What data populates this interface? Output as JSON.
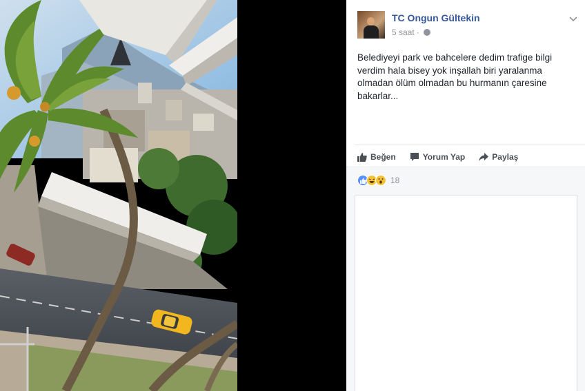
{
  "post": {
    "author": "TC Ongun Gültekin",
    "time": "5 saat",
    "separator": "·",
    "text": "Belediyeyi park ve bahcelere dedim trafige bilgi verdim hala bisey yok inşallah biri yaralanma olmadan ölüm olmadan bu hurmanın çaresine bakarlar...",
    "privacy_icon": "globe-icon",
    "menu_icon": "chevron-down-icon"
  },
  "actions": {
    "like_label": "Beğen",
    "comment_label": "Yorum Yap",
    "share_label": "Paylaş"
  },
  "reactions": {
    "types": [
      "like",
      "haha",
      "wow"
    ],
    "count": "18"
  },
  "photo": {
    "subject": "street-view-from-balcony"
  },
  "colors": {
    "link": "#365899",
    "like_blue": "#5890ff",
    "reaction_yellow": "#f5c33b",
    "meta_gray": "#90949c"
  }
}
